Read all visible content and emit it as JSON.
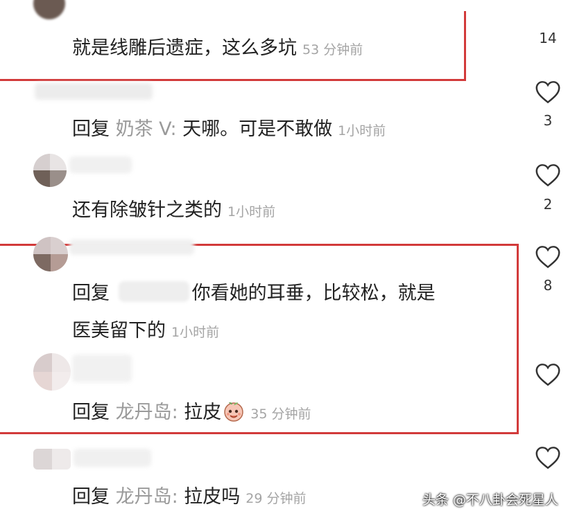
{
  "comments": [
    {
      "id": "c1",
      "text": "就是线雕后遗症，这么多坑",
      "time": "53 分钟前",
      "likes": "14"
    },
    {
      "id": "c2",
      "reply_word": "回复",
      "reply_to": "奶茶 V:",
      "text": " 天哪。可是不敢做",
      "time": "1小时前",
      "likes": "3"
    },
    {
      "id": "c3",
      "text": "还有除皱针之类的",
      "time": "1小时前",
      "likes": "2"
    },
    {
      "id": "c4",
      "reply_word": "回复",
      "text_line1": "你看她的耳垂，比较松，就是",
      "text_line2": "医美留下的",
      "time": "1小时前",
      "likes": "8"
    },
    {
      "id": "c5",
      "reply_word": "回复",
      "reply_to": "龙丹岛:",
      "text": " 拉皮",
      "time": "35 分钟前",
      "likes": ""
    },
    {
      "id": "c6",
      "reply_word": "回复",
      "reply_to": "龙丹岛:",
      "text": " 拉皮吗",
      "time": "29 分钟前",
      "likes": ""
    }
  ],
  "icons": {
    "like": "heart-outline-icon",
    "sticker": "peach-sticker-icon"
  },
  "colors": {
    "highlight": "#d23a3a",
    "timestamp": "#a4a4a4",
    "reply_name": "#9a9a9a"
  },
  "watermark": "头条 @不八卦会死星人"
}
